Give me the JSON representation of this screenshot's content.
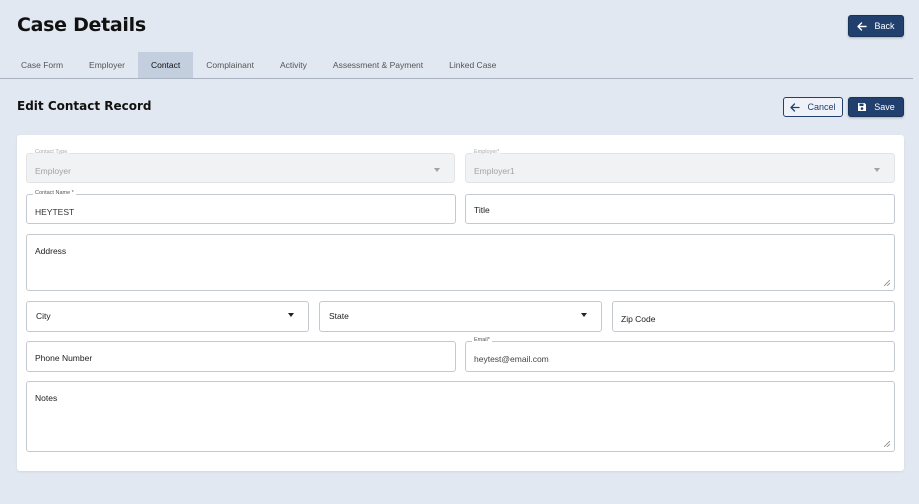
{
  "header": {
    "title": "Case Details",
    "back_label": "Back"
  },
  "tabs": [
    {
      "label": "Case Form"
    },
    {
      "label": "Employer"
    },
    {
      "label": "Contact"
    },
    {
      "label": "Complainant"
    },
    {
      "label": "Activity"
    },
    {
      "label": "Assessment & Payment"
    },
    {
      "label": "Linked Case"
    }
  ],
  "active_tab": "Contact",
  "section": {
    "title": "Edit Contact Record",
    "cancel_label": "Cancel",
    "save_label": "Save"
  },
  "form": {
    "contact_type": {
      "label": "Contact Type",
      "value": "Employer"
    },
    "employer": {
      "label": "Employer*",
      "value": "Employer1"
    },
    "contact_name": {
      "label": "Contact Name *",
      "value": "HEYTEST"
    },
    "title": {
      "placeholder": "Title"
    },
    "address": {
      "placeholder": "Address"
    },
    "city": {
      "placeholder": "City"
    },
    "state": {
      "placeholder": "State"
    },
    "zip_code": {
      "placeholder": "Zip Code"
    },
    "phone_number": {
      "placeholder": "Phone Number"
    },
    "email": {
      "label": "Email*",
      "value": "heytest@email.com"
    },
    "notes": {
      "placeholder": "Notes"
    }
  },
  "icons": {
    "back": "arrow-left-icon",
    "cancel": "arrow-left-icon",
    "save": "floppy-disk-icon"
  },
  "colors": {
    "primary": "#22406e",
    "background": "#e2e8f1",
    "active_tab": "#c3cede"
  }
}
